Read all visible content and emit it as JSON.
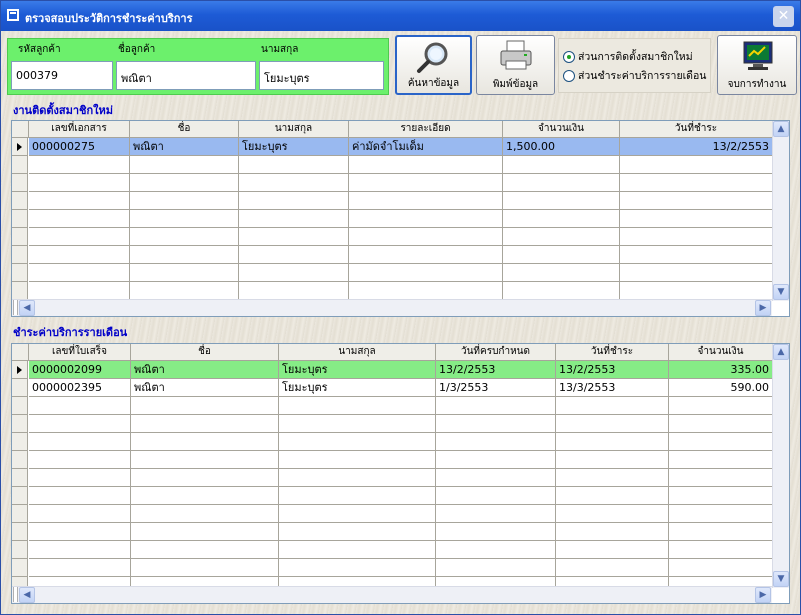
{
  "window": {
    "title": "ตรวจสอบประวัติการชำระค่าบริการ"
  },
  "customer": {
    "id_label": "รหัสลูกค้า",
    "id_value": "000379",
    "name_label": "ชื่อลูกค้า",
    "name_value": "พณิตา",
    "surname_label": "นามสกุล",
    "surname_value": "โยมะบุตร"
  },
  "toolbar": {
    "search_label": "ค้นหาข้อมูล",
    "print_label": "พิมพ์ข้อมูล",
    "exit_label": "จบการทำงาน"
  },
  "options": {
    "install_label": "ส่วนการติดตั้งสมาชิกใหม่",
    "monthly_label": "ส่วนชำระค่าบริการรายเดือน",
    "selected": "install"
  },
  "install_grid": {
    "title": "งานติดตั้งสมาชิกใหม่",
    "columns": [
      "เลขที่เอกสาร",
      "ชื่อ",
      "นามสกุล",
      "รายละเอียด",
      "จำนวนเงิน",
      "วันที่ชำระ"
    ],
    "rows": [
      [
        "000000275",
        "พณิตา",
        "โยมะบุตร",
        "ค่ามัดจำโมเด็ม",
        "1,500.00",
        "13/2/2553"
      ]
    ],
    "selected_color": "#99b9f0"
  },
  "monthly_grid": {
    "title": "ชำระค่าบริการรายเดือน",
    "columns": [
      "เลขที่ใบเสร็จ",
      "ชื่อ",
      "นามสกุล",
      "วันที่ครบกำหนด",
      "วันที่ชำระ",
      "จำนวนเงิน"
    ],
    "rows": [
      [
        "0000002099",
        "พณิตา",
        "โยมะบุตร",
        "13/2/2553",
        "13/2/2553",
        "335.00"
      ],
      [
        "0000002395",
        "พณิตา",
        "โยมะบุตร",
        "1/3/2553",
        "13/3/2553",
        "590.00"
      ]
    ],
    "selected_color": "#86ec86"
  }
}
